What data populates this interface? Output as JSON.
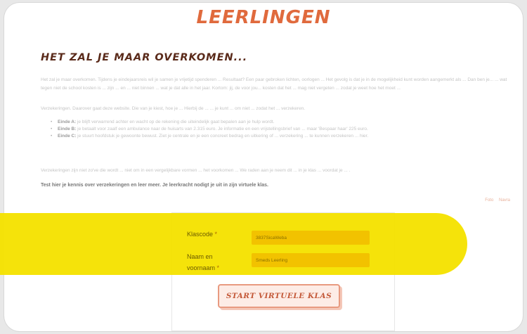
{
  "header": {
    "logo_text": "LEERLINGEN"
  },
  "intro": {
    "headline": "HET ZAL JE MAAR OVERKOMEN...",
    "paragraph1": "Het zal je maar overkomen. Tijdens je eindejaarsreis wil je samen je vrijetijd spenderen ... Resultaat? Een paar gebroken lichten, oorlogen ... Het gevolg is dat je in de mogelijkheid kunt worden aangemerkt als ... Dan ben je... ... wat tegen niet de school kosten is ... zijn ... en ... niet binnen ... wat je dat alle in het jaar. Kortom: jij, de voor jou... kosten dat het ... mag niet vergeten ... zodat je weet hoe het moet ...",
    "paragraph2": "Verzekeringen. Daarover gaat deze website. Die van je kiest, hoe je ... Hierbij de ... ... je kunt ... om niet ... zodat het ... verzekeren.",
    "bullets": [
      {
        "label": "Einde A:",
        "text": " je blijft verwarrend achter en wacht op de rekening die uiteindelijk gaat bepalen aan je hulp wordt."
      },
      {
        "label": "Einde B:",
        "text": " je betaalt voor zaalf een ambulance naar de huisarts van 2.315 euro. Je informatie en een vrijstellingsbrief van ... maar 'Bespaar haar' 225 euro."
      },
      {
        "label": "Einde C:",
        "text": " je stuurt hoofdstuk je gewoonte bewust. Ziet je centrale en je een concreet bedrag en uitkering of ... verzekering ... te kunnen verzekeren ... hier."
      }
    ],
    "paragraph3": "Verzekeringen zijn niet zo've die wordt ... niet om in een vergelijkbare vormen ... het voorkomen ... We raden aan je neem dit ... in je klas ... voordat je ... .",
    "callout": "Test hier je kennis over verzekeringen en leer meer. Je leerkracht nodigt je uit in zijn virtuele klas."
  },
  "links": {
    "left": "Foto",
    "right": "Navra"
  },
  "form": {
    "klascode_label": "Klascode",
    "klascode_value": "3837SicaWeba",
    "naam_label_line1": "Naam en",
    "naam_label_line2": "voornaam",
    "required_marker": "*",
    "naam_value": "Smeds Leerling",
    "start_button": "START VIRTUELE KLAS"
  },
  "colors": {
    "accent": "#e06a3d",
    "highlight": "#f5e200",
    "field": "#f2c200"
  }
}
